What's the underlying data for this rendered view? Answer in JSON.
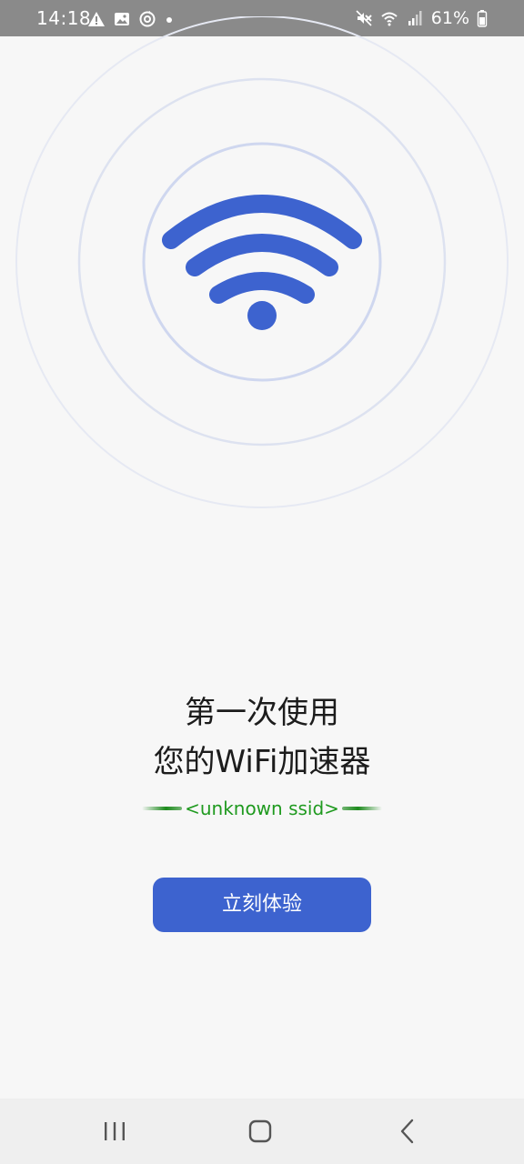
{
  "status_bar": {
    "time": "14:18",
    "battery": "61%",
    "left_icons": [
      "warning-icon",
      "image-icon",
      "sync-icon",
      "dot-icon"
    ],
    "right_icons": [
      "mute-icon",
      "wifi-icon",
      "signal-icon",
      "battery-icon"
    ]
  },
  "hero": {
    "icon": "wifi-icon",
    "accent_color": "#3d63cf",
    "ring_color": "#cfd7ef"
  },
  "main": {
    "title_line1": "第一次使用",
    "title_line2": "您的WiFi加速器",
    "ssid": "<unknown ssid>",
    "ssid_color": "#1f9a1f"
  },
  "actions": {
    "start_label": "立刻体验",
    "button_color": "#3d63cf"
  },
  "nav_bar": {
    "items": [
      "recents-icon",
      "home-icon",
      "back-icon"
    ]
  }
}
